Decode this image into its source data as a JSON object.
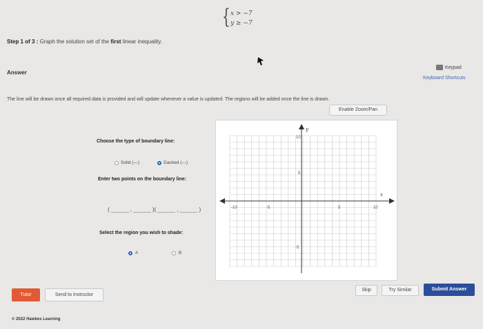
{
  "problem": {
    "ineq1": "x > −7",
    "ineq2": "y ≥ −7"
  },
  "step": {
    "prefix": "Step 1 of 3 :",
    "text": "Graph the solution set of the",
    "bold": "first",
    "suffix": "linear inequality."
  },
  "answer_label": "Answer",
  "keypad_label": "Keypad",
  "shortcuts_label": "Keyboard Shortcuts",
  "hint": "The line will be drawn once all required data is provided and will update whenever a value is updated. The regions will be added once the line is drawn.",
  "zoom_label": "Enable Zoom/Pan",
  "boundary": {
    "title": "Choose the type of boundary line:",
    "solid_label": "Solid (—)",
    "dashed_label": "Dashed (---)",
    "selected": "dashed"
  },
  "points": {
    "title": "Enter two points on the boundary line:",
    "open": "(",
    "comma": ",",
    "mid": ")(",
    "close": ")"
  },
  "region": {
    "title": "Select the region you wish to shade:",
    "a": "A",
    "b": "B",
    "selected": "A"
  },
  "graph": {
    "x_label": "x",
    "y_label": "y",
    "ticks": {
      "y_top": "10",
      "y_mid": "5",
      "y_bottom": "-5",
      "x_left": "-10",
      "x_neg5": "-5",
      "x_pos5": "5",
      "x_right": "10"
    },
    "range": [
      -10,
      10
    ]
  },
  "buttons": {
    "tutor": "Tutor",
    "send": "Send to Instructor",
    "skip": "Skip",
    "similar": "Try Similar",
    "submit": "Submit Answer"
  },
  "copyright": "© 2022 Hawkes Learning",
  "colors": {
    "tutor": "#e15a36",
    "submit": "#2c4d9a",
    "radio_selected": "#2d5fb0"
  }
}
